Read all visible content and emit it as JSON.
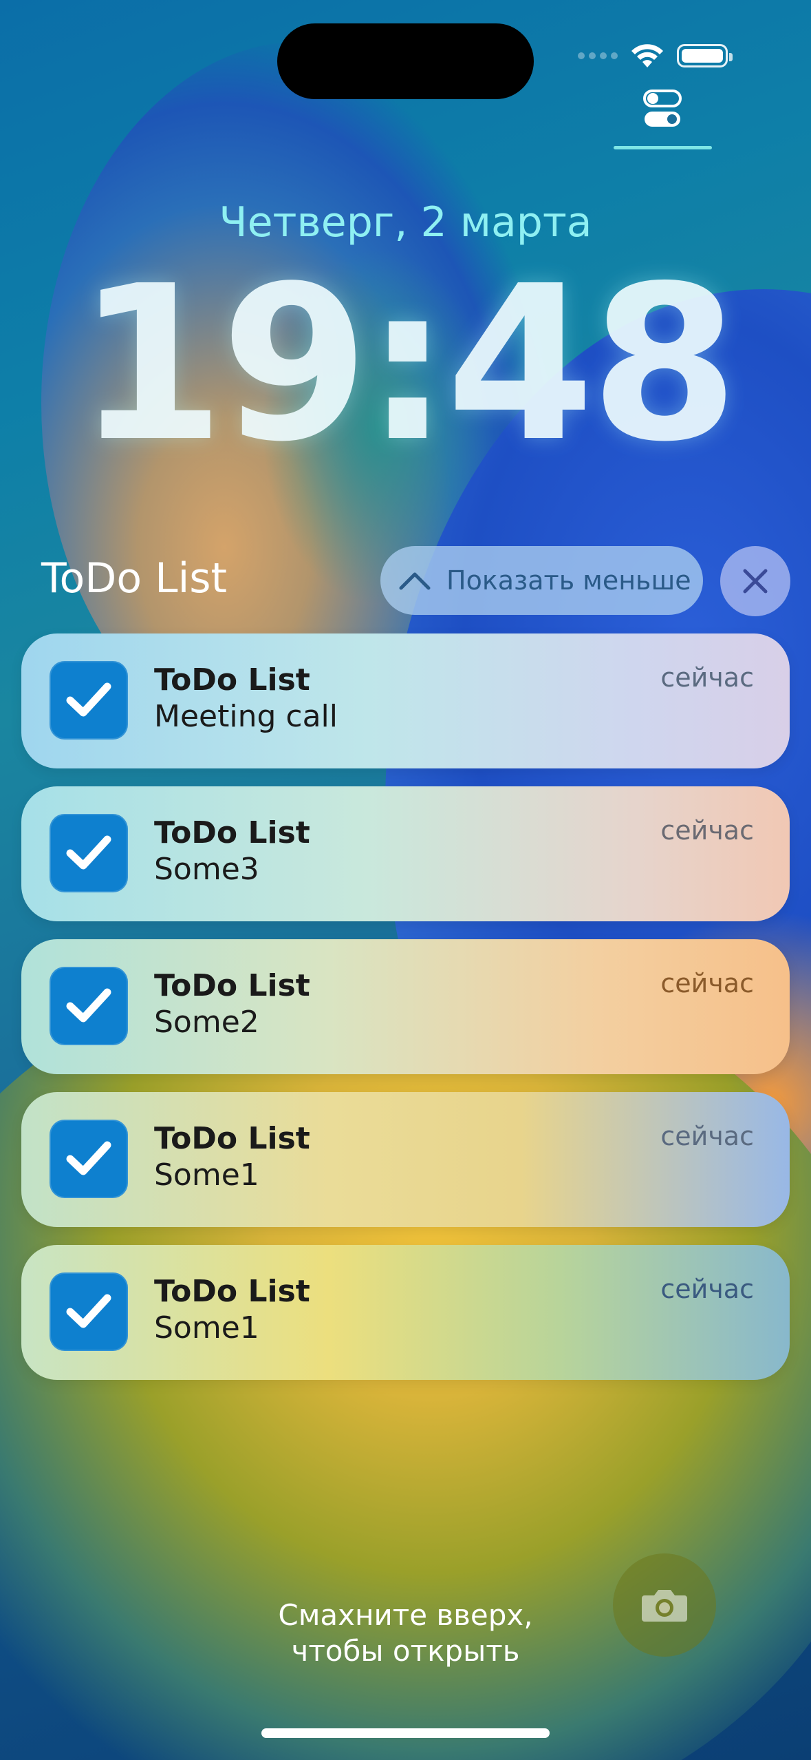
{
  "status_bar": {
    "icons": [
      "signal-dots-icon",
      "wifi-icon",
      "battery-icon"
    ],
    "focus_icon": "focus-toggle-icon"
  },
  "lock_screen": {
    "date": "Четверг, 2 марта",
    "time": "19:48"
  },
  "notification_group": {
    "title": "ToDo List",
    "show_less_label": "Показать меньше",
    "close_icon": "close-icon",
    "chevron_icon": "chevron-up-icon"
  },
  "notifications": [
    {
      "app": "ToDo List",
      "body": "Meeting call",
      "time": "сейчас",
      "icon": "checkbox-check-icon"
    },
    {
      "app": "ToDo List",
      "body": "Some3",
      "time": "сейчас",
      "icon": "checkbox-check-icon"
    },
    {
      "app": "ToDo List",
      "body": "Some2",
      "time": "сейчас",
      "icon": "checkbox-check-icon"
    },
    {
      "app": "ToDo List",
      "body": "Some1",
      "time": "сейчас",
      "icon": "checkbox-check-icon"
    },
    {
      "app": "ToDo List",
      "body": "Some1",
      "time": "сейчас",
      "icon": "checkbox-check-icon"
    }
  ],
  "footer": {
    "swipe_line1": "Смахните вверх,",
    "swipe_line2": "чтобы открыть",
    "camera_icon": "camera-icon"
  },
  "colors": {
    "app_icon": "#0e80cf",
    "date_text": "#8ff0f2",
    "show_less_text": "#2a5a88"
  }
}
